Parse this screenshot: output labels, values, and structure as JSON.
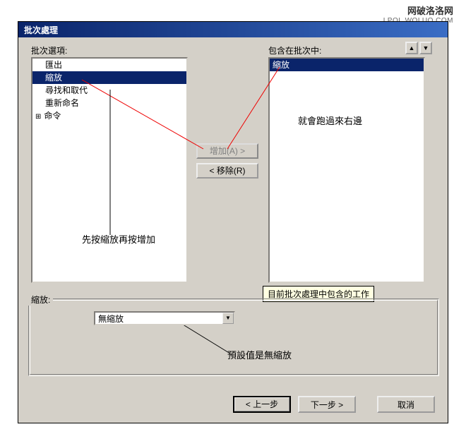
{
  "watermark": {
    "line1": "网破洛洛网",
    "line2": "LPOL.WOLUO.COM"
  },
  "dialog": {
    "title": "批次處理",
    "left_list_label": "批次選項:",
    "right_list_label": "包含在批次中:",
    "left_items": {
      "item0": "匯出",
      "item1": "縮放",
      "item2": "尋找和取代",
      "item3": "重新命名",
      "item4": "命令"
    },
    "right_items": {
      "item0": "縮放"
    },
    "add_button": "增加(A) >",
    "remove_button": "< 移除(R)",
    "tooltip": "目前批次處理中包含的工作",
    "group_label": "縮放:",
    "dropdown_value": "無縮放",
    "prev_button": "< 上一步",
    "next_button": "下一步 >",
    "cancel_button": "取消"
  },
  "annotations": {
    "a1": "就會跑過來右邊",
    "a2": "先按縮放再按增加",
    "a3": "預設值是無縮放"
  }
}
